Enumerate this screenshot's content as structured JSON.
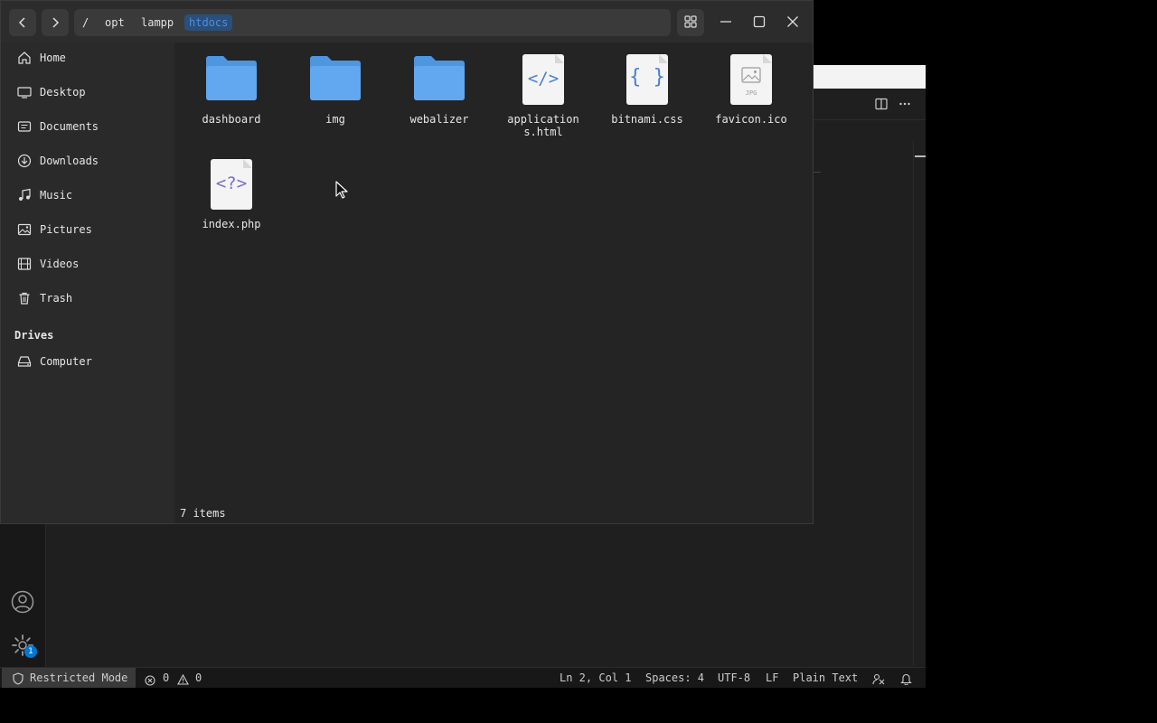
{
  "file_manager": {
    "path": {
      "root": "/",
      "segments": [
        "opt",
        "lampp",
        "htdocs"
      ]
    },
    "sidebar": {
      "places": [
        {
          "label": "Home",
          "icon": "home-icon"
        },
        {
          "label": "Desktop",
          "icon": "desktop-icon"
        },
        {
          "label": "Documents",
          "icon": "documents-icon"
        },
        {
          "label": "Downloads",
          "icon": "downloads-icon"
        },
        {
          "label": "Music",
          "icon": "music-icon"
        },
        {
          "label": "Pictures",
          "icon": "pictures-icon"
        },
        {
          "label": "Videos",
          "icon": "videos-icon"
        },
        {
          "label": "Trash",
          "icon": "trash-icon"
        }
      ],
      "drives_title": "Drives",
      "drives": [
        {
          "label": "Computer",
          "icon": "drive-icon"
        }
      ]
    },
    "files": [
      {
        "name": "dashboard",
        "type": "folder"
      },
      {
        "name": "img",
        "type": "folder"
      },
      {
        "name": "webalizer",
        "type": "folder"
      },
      {
        "name": "applications.html",
        "type": "html",
        "glyph": "</>"
      },
      {
        "name": "bitnami.css",
        "type": "css",
        "glyph": "{ }"
      },
      {
        "name": "favicon.ico",
        "type": "image",
        "glyph": "JPG"
      },
      {
        "name": "index.php",
        "type": "php",
        "glyph": "<?>"
      }
    ],
    "status": "7 items"
  },
  "editor": {
    "statusbar": {
      "mode": "Restricted Mode",
      "errors": "0",
      "warnings": "0",
      "position": "Ln 2, Col 1",
      "spaces": "Spaces: 4",
      "encoding": "UTF-8",
      "eol": "LF",
      "language": "Plain Text"
    },
    "settings_badge": "1"
  },
  "colors": {
    "folder": "#5aa0e8",
    "accent": "#4a90e2",
    "badge": "#0078d4"
  }
}
